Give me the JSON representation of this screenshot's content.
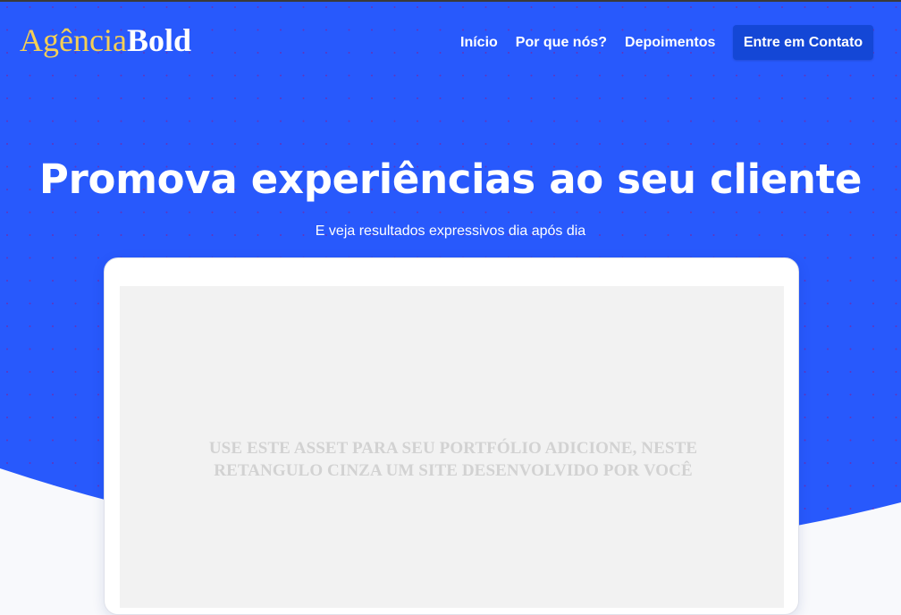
{
  "brand": {
    "name_light": "Agência",
    "name_bold": "Bold"
  },
  "nav": {
    "links": [
      {
        "label": "Início"
      },
      {
        "label": "Por que nós?"
      },
      {
        "label": "Depoimentos"
      }
    ],
    "cta_label": "Entre em Contato"
  },
  "hero": {
    "title": "Promova experiências ao seu cliente",
    "subtitle": "E veja resultados expressivos dia após dia"
  },
  "mockup": {
    "placeholder_line1": "USE ESTE ASSET PARA SEU PORTFÓLIO ADICIONE, NESTE",
    "placeholder_line2": "RETANGULO CINZA UM SITE DESENVOLVIDO POR VOCÊ"
  },
  "colors": {
    "hero_blue": "#2859fc",
    "logo_accent": "#f5cf55",
    "cta_blue": "#1447d6",
    "dot_pattern": "#6a2fb0",
    "page_background": "#f8f9fc",
    "mockup_screen": "#f2f2f2"
  }
}
